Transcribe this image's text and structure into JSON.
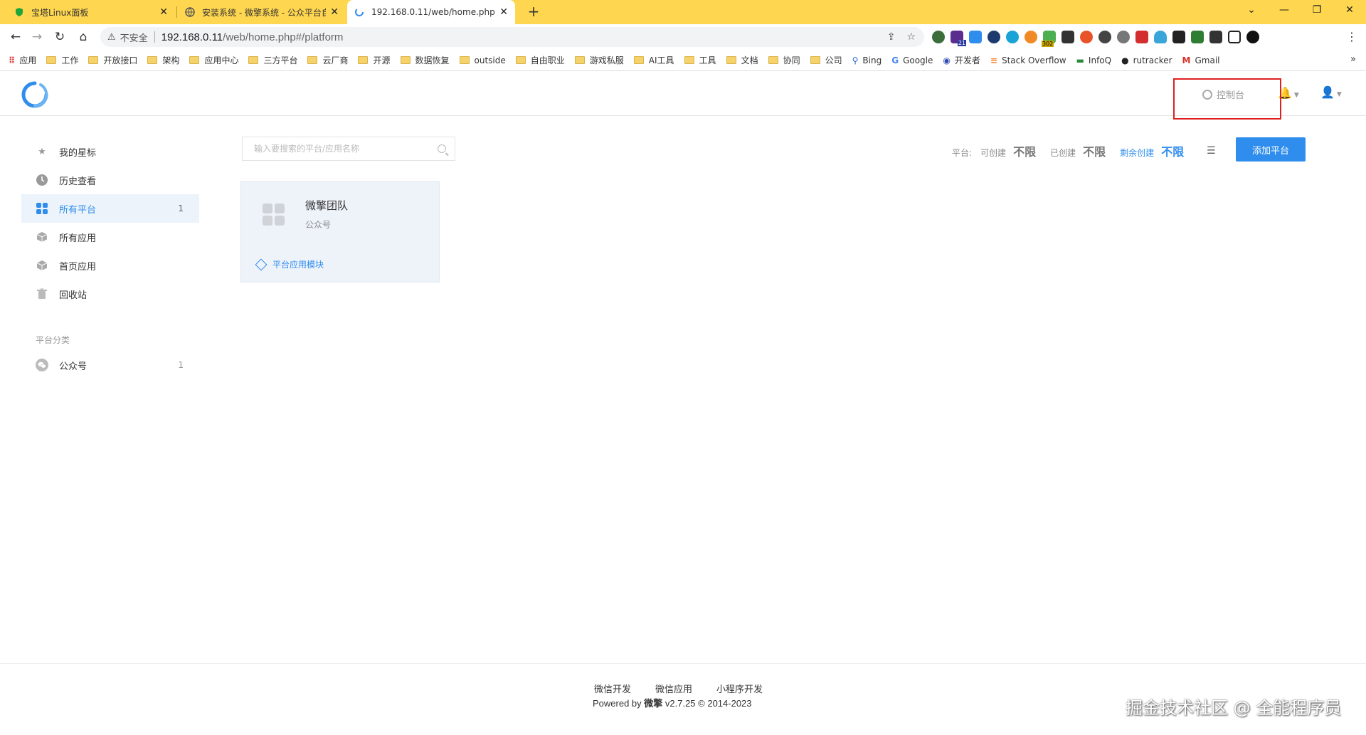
{
  "browser": {
    "tabs": [
      {
        "title": "宝塔Linux面板",
        "active": false
      },
      {
        "title": "安装系统 - 微擎系统 - 公众平台自…",
        "active": false
      },
      {
        "title": "192.168.0.11/web/home.php#",
        "active": true
      }
    ],
    "new_tab": "+",
    "window_controls": {
      "minimize": "⌄",
      "min2": "—",
      "restore": "❐",
      "close": "✕"
    },
    "insecure_label": "不安全",
    "url_host": "192.168.0.11",
    "url_path": "/web/home.php#/platform",
    "bookmarks": [
      {
        "label": "应用",
        "kind": "apps"
      },
      {
        "label": "工作",
        "kind": "folder"
      },
      {
        "label": "开放接口",
        "kind": "folder"
      },
      {
        "label": "架构",
        "kind": "folder"
      },
      {
        "label": "应用中心",
        "kind": "folder"
      },
      {
        "label": "三方平台",
        "kind": "folder"
      },
      {
        "label": "云厂商",
        "kind": "folder"
      },
      {
        "label": "开源",
        "kind": "folder"
      },
      {
        "label": "数据恢复",
        "kind": "folder"
      },
      {
        "label": "outside",
        "kind": "folder"
      },
      {
        "label": "自由职业",
        "kind": "folder"
      },
      {
        "label": "游戏私服",
        "kind": "folder"
      },
      {
        "label": "AI工具",
        "kind": "folder"
      },
      {
        "label": "工具",
        "kind": "folder"
      },
      {
        "label": "文档",
        "kind": "folder"
      },
      {
        "label": "协同",
        "kind": "folder"
      },
      {
        "label": "公司",
        "kind": "folder"
      },
      {
        "label": "Bing",
        "kind": "site"
      },
      {
        "label": "Google",
        "kind": "site"
      },
      {
        "label": "开发者",
        "kind": "site"
      },
      {
        "label": "Stack Overflow",
        "kind": "site"
      },
      {
        "label": "InfoQ",
        "kind": "site"
      },
      {
        "label": "rutracker",
        "kind": "site"
      },
      {
        "label": "Gmail",
        "kind": "site"
      }
    ],
    "bookmarks_more": "»",
    "extension_badges": {
      "a": "21",
      "b": "302"
    }
  },
  "header": {
    "console_label": "控制台"
  },
  "sidebar": {
    "items": [
      {
        "label": "我的星标",
        "icon": "star-icon",
        "count": ""
      },
      {
        "label": "历史查看",
        "icon": "clock-icon",
        "count": ""
      },
      {
        "label": "所有平台",
        "icon": "grid-icon",
        "count": "1"
      },
      {
        "label": "所有应用",
        "icon": "cube-icon",
        "count": ""
      },
      {
        "label": "首页应用",
        "icon": "cube-icon",
        "count": ""
      },
      {
        "label": "回收站",
        "icon": "trash-icon",
        "count": ""
      }
    ],
    "section_title": "平台分类",
    "categories": [
      {
        "label": "公众号",
        "icon": "wechat-icon",
        "count": "1"
      }
    ]
  },
  "main": {
    "search_placeholder": "输入要搜索的平台/应用名称",
    "stats": {
      "prefix": "平台:",
      "can_create_label": "可创建",
      "can_create_value": "不限",
      "created_label": "已创建",
      "created_value": "不限",
      "remaining_label": "剩余创建",
      "remaining_value": "不限"
    },
    "add_button": "添加平台",
    "card": {
      "name": "微擎团队",
      "type": "公众号",
      "module_link": "平台应用模块"
    }
  },
  "footer": {
    "links": [
      "微信开发",
      "微信应用",
      "小程序开发"
    ],
    "powered_prefix": "Powered by ",
    "powered_brand": "微擎",
    "powered_suffix": " v2.7.25 © 2014-2023",
    "watermark": "掘金技术社区 @ 全能程序员"
  },
  "colors": {
    "accent": "#2e8ded",
    "tabstrip": "#fed64f",
    "highlight_box": "#e02020"
  }
}
